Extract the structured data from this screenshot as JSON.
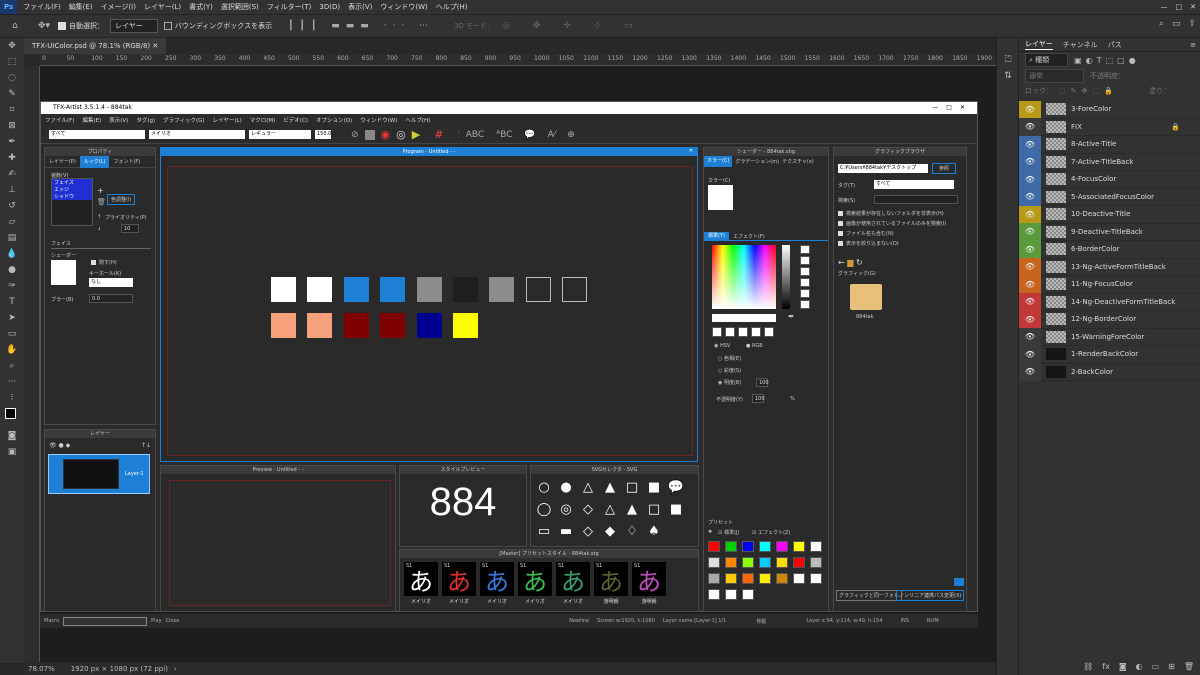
{
  "ps_menu": [
    "ファイル(F)",
    "編集(E)",
    "イメージ(I)",
    "レイヤー(L)",
    "書式(Y)",
    "選択範囲(S)",
    "フィルター(T)",
    "3D(D)",
    "表示(V)",
    "ウィンドウ(W)",
    "ヘルプ(H)"
  ],
  "ps_options": {
    "auto_select": "自動選択：",
    "layer_select": "レイヤー",
    "bbox": "バウンディングボックスを表示",
    "mode3d": "3D モード："
  },
  "doc_tab": "TFX-UIColor.psd @ 78.1% (RGB/8)",
  "ruler_ticks": [
    "0",
    "50",
    "100",
    "150",
    "200",
    "250",
    "300",
    "350",
    "400",
    "450",
    "500",
    "550",
    "600",
    "650",
    "700",
    "750",
    "800",
    "850",
    "900",
    "950",
    "1000",
    "1050",
    "1100",
    "1150",
    "1200",
    "1250",
    "1300",
    "1350",
    "1400",
    "1450",
    "1500",
    "1550",
    "1600",
    "1650",
    "1700",
    "1750",
    "1800",
    "1850",
    "1900"
  ],
  "status": {
    "zoom": "78.07%",
    "size": "1920 px × 1080 px (72 ppi)"
  },
  "layers_panel": {
    "tabs": [
      "レイヤー",
      "チャンネル",
      "パス"
    ],
    "kind": "種類",
    "blend": "通常",
    "opacity_label": "不透明度：",
    "fill_label": "塗り：",
    "lock_label": "ロック：",
    "layers": [
      {
        "name": "3-ForeColor",
        "color": "#b89a18"
      },
      {
        "name": "FIX",
        "color": "",
        "locked": true
      },
      {
        "name": "8-Active-Title",
        "color": "#3e6aa8"
      },
      {
        "name": "7-Active-TitleBack",
        "color": "#3e6aa8"
      },
      {
        "name": "4-FocusColor",
        "color": "#3e6aa8"
      },
      {
        "name": "5-AssociatedFocusColor",
        "color": "#3e6aa8"
      },
      {
        "name": "10-Deactive-Title",
        "color": "#b89a18"
      },
      {
        "name": "9-Deactive-TitleBack",
        "color": "#5a9a3a"
      },
      {
        "name": "6-BorderColor",
        "color": "#5a9a3a"
      },
      {
        "name": "13-Ng-ActiveFormTitleBack",
        "color": "#c8641e"
      },
      {
        "name": "11-Ng-FocusColor",
        "color": "#c8641e"
      },
      {
        "name": "14-Ng-DeactiveFormTitleBack",
        "color": "#c03838"
      },
      {
        "name": "12-Ng-BorderColor",
        "color": "#c03838"
      },
      {
        "name": "15-WarningForeColor",
        "color": ""
      },
      {
        "name": "1-RenderBackColor",
        "color": ""
      },
      {
        "name": "2-BackColor",
        "color": ""
      }
    ]
  },
  "tfx": {
    "title": "TFX-Artist 3.5.1.4 - 884tak",
    "menu": [
      "ファイル(F)",
      "編集(E)",
      "表示(V)",
      "タグ(g)",
      "グラフィック(G)",
      "レイヤー(L)",
      "マクロ(M)",
      "ビデオ(C)",
      "オプション(O)",
      "ウィンドウ(W)",
      "ヘルプ(H)"
    ],
    "toolbar": {
      "sel1": "すべて",
      "sel2": "メイリオ",
      "sel3": "レギュラー",
      "size": "150.0"
    },
    "props": {
      "title": "プロパティ",
      "tabs": [
        "レイヤー(P)",
        "ルック(L)",
        "フォント(F)"
      ],
      "list_label": "装飾(V)",
      "items": [
        "フェイス",
        "エッジ",
        "シャドウ"
      ],
      "color_btn": "色調整(I)",
      "priority": "プライオリティ(P)",
      "priority_val": "10",
      "face": "フェイス",
      "shader": "シェーダー",
      "hide": "隠す(H)",
      "kernel": "キーホール(K)",
      "kernel_val": "なし",
      "blur": "ブラー(B)",
      "blur_val": "0.0"
    },
    "layer_panel": {
      "title": "レイヤー",
      "item": "Layer-1"
    },
    "program": {
      "title": "Program - Untitled - -"
    },
    "preview": {
      "title": "Preview - Untitled - -"
    },
    "style_preview": {
      "title": "スタイルプレビュー",
      "text": "884"
    },
    "svg_panel": {
      "title": "SVGセレクタ - SVG",
      "shapes": [
        "○",
        "●",
        "△",
        "▲",
        "□",
        "■",
        "💬",
        "◯",
        "◎",
        "◇",
        "△",
        "▲",
        "□",
        "■",
        "▭",
        "▬",
        "◇",
        "◆",
        "♢",
        "♠"
      ]
    },
    "preset_panel": {
      "title": "[Master] プリセットスタイル - 884tak.stg",
      "items": [
        {
          "g": "あ",
          "c": "#ffffff",
          "l": "メイリオ"
        },
        {
          "g": "あ",
          "c": "#e03030",
          "l": "メイリオ"
        },
        {
          "g": "あ",
          "c": "#3a7ae0",
          "l": "メイリオ"
        },
        {
          "g": "あ",
          "c": "#3ac050",
          "l": "メイリオ"
        },
        {
          "g": "あ",
          "c": "#3aa070",
          "l": "メイリオ"
        },
        {
          "g": "あ",
          "c": "#606030",
          "l": "游明朝"
        },
        {
          "g": "あ",
          "c": "#c050c0",
          "l": "游明朝"
        }
      ]
    },
    "shader_panel": {
      "title": "シェーダー - 884tak.shg",
      "tabs": [
        "カラー(C)",
        "グラデーション(m)",
        "テクスチャ(x)"
      ],
      "color_label": "カラー(C)",
      "std_tabs": [
        "標準(Y)",
        "エフェクト(F)"
      ],
      "hsv": "HSV",
      "rgb": "RGB",
      "hue": "色相(E)",
      "sat": "彩度(S)",
      "val": "明度(B)",
      "val_v": "100",
      "opacity": "不透明度(Y)",
      "opacity_v": "100",
      "pct": "%",
      "preset": "プリセット",
      "std": "標準(J)",
      "eff": "エフェクト(Z)"
    },
    "browser": {
      "title": "グラフィックブラウザ",
      "path": "C:¥Users¥884tak¥デスクトップ",
      "ref": "参照",
      "tag": "タグ(T)",
      "tag_v": "すべて",
      "search": "検索(S)",
      "opts": [
        "検索結果が存在しないフォルダを非表示(H)",
        "画像が使用されているファイルのみを検索(I)",
        "ファイル名も含む(N)",
        "表示を絞り込まない(D)"
      ],
      "graphic": "グラフィック(G)",
      "folder": "884tak",
      "btn1": "グラフィックと同一フォル",
      "btn2": "ノンリニア連携パス変更(X)"
    },
    "statusbar": {
      "macro": "Macro",
      "play": "Play",
      "close": "Close",
      "newline": "Newline",
      "screen": "Screen w:1920, h:1080",
      "layer": "Layer name [Layer-1] 1/1",
      "move": "移動",
      "pos": "Layer  x:94, y:114, w:49, h:154",
      "ins": "INS",
      "num": "NUM"
    }
  },
  "swatches_row1": [
    "#ffffff",
    "#ffffff",
    "#1e7fd6",
    "#1e7fd6",
    "#8c8c8c",
    "#1e1e1e",
    "#8c8c8c",
    "#2a2a2a",
    "#2a2a2a"
  ],
  "swatches_row2": [
    "#f7a07c",
    "#f7a07c",
    "#800000",
    "#800000",
    "#000090",
    "#ffff00"
  ],
  "preset_colors": [
    "#ff0000",
    "#00d000",
    "#0000ff",
    "#00ffff",
    "#ff00ff",
    "#ffff00",
    "#ffffff",
    "#dddddd",
    "#ff8800",
    "#88ff00",
    "#00ccff",
    "#ffdd00",
    "#ff0000",
    "#bbbbbb",
    "#aaa",
    "#ffcc00",
    "#ff6600",
    "#ffee00",
    "#cc8800",
    "#ffffff",
    "#ffffff",
    "#ffffff",
    "#ffffff",
    "#ffffff"
  ]
}
